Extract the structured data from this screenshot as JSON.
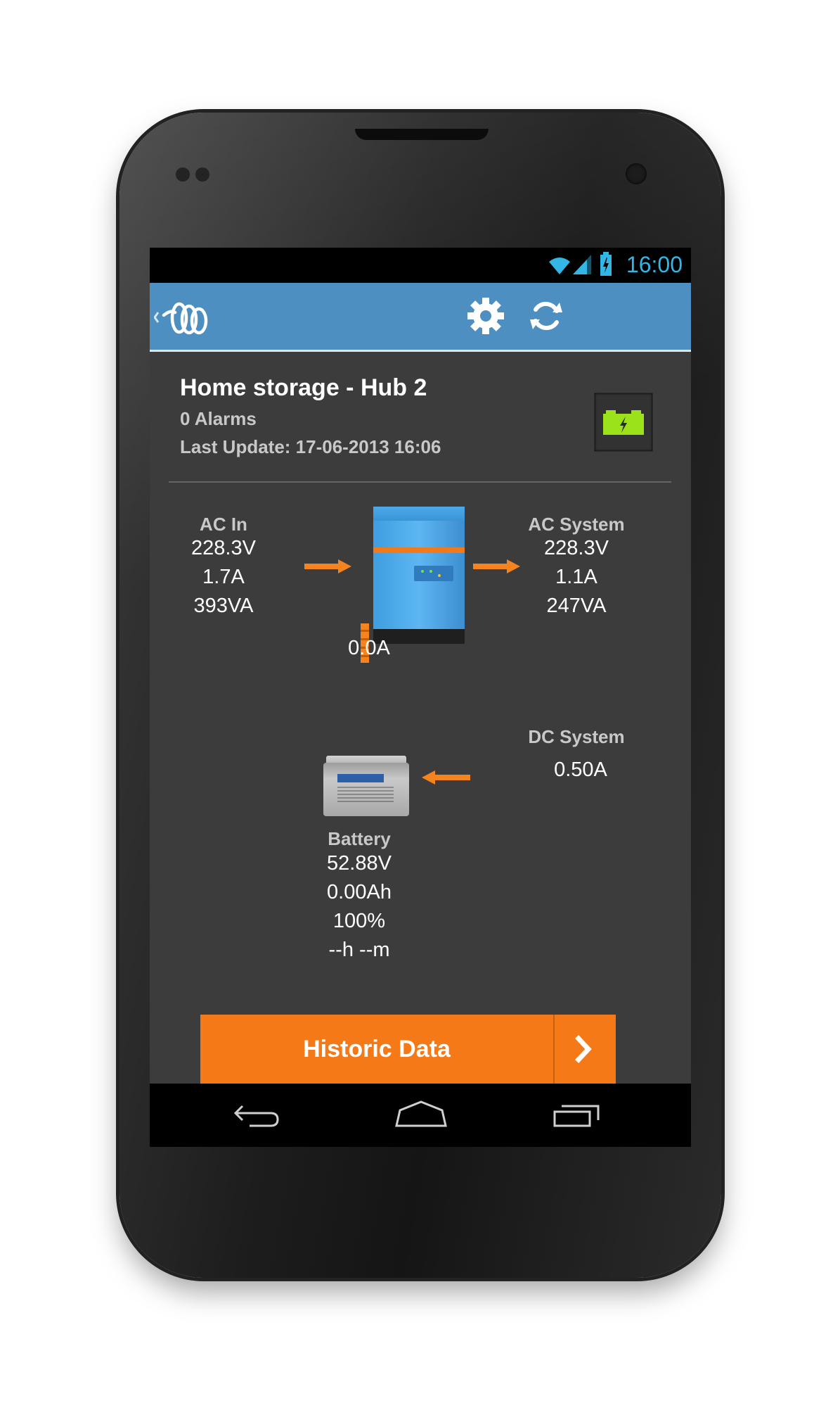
{
  "status_bar": {
    "time": "16:00"
  },
  "app_bar": {},
  "site": {
    "title": "Home storage - Hub 2",
    "alarms": "0 Alarms",
    "last_update": "Last Update: 17-06-2013 16:06"
  },
  "ac_in": {
    "label": "AC In",
    "voltage": "228.3V",
    "current": "1.7A",
    "power": "393VA"
  },
  "ac_system": {
    "label": "AC System",
    "voltage": "228.3V",
    "current": "1.1A",
    "power": "247VA"
  },
  "dc_bus": {
    "current": "0.0A"
  },
  "dc_system": {
    "label": "DC System",
    "current": "0.50A"
  },
  "battery": {
    "label": "Battery",
    "voltage": "52.88V",
    "consumed": "0.00Ah",
    "soc": "100%",
    "time_to_go": "--h --m"
  },
  "historic_button": {
    "label": "Historic Data"
  },
  "colors": {
    "accent": "#f57a17",
    "appbar": "#4d8fc0",
    "status_blue": "#33b5e5",
    "background": "#3c3c3c"
  }
}
